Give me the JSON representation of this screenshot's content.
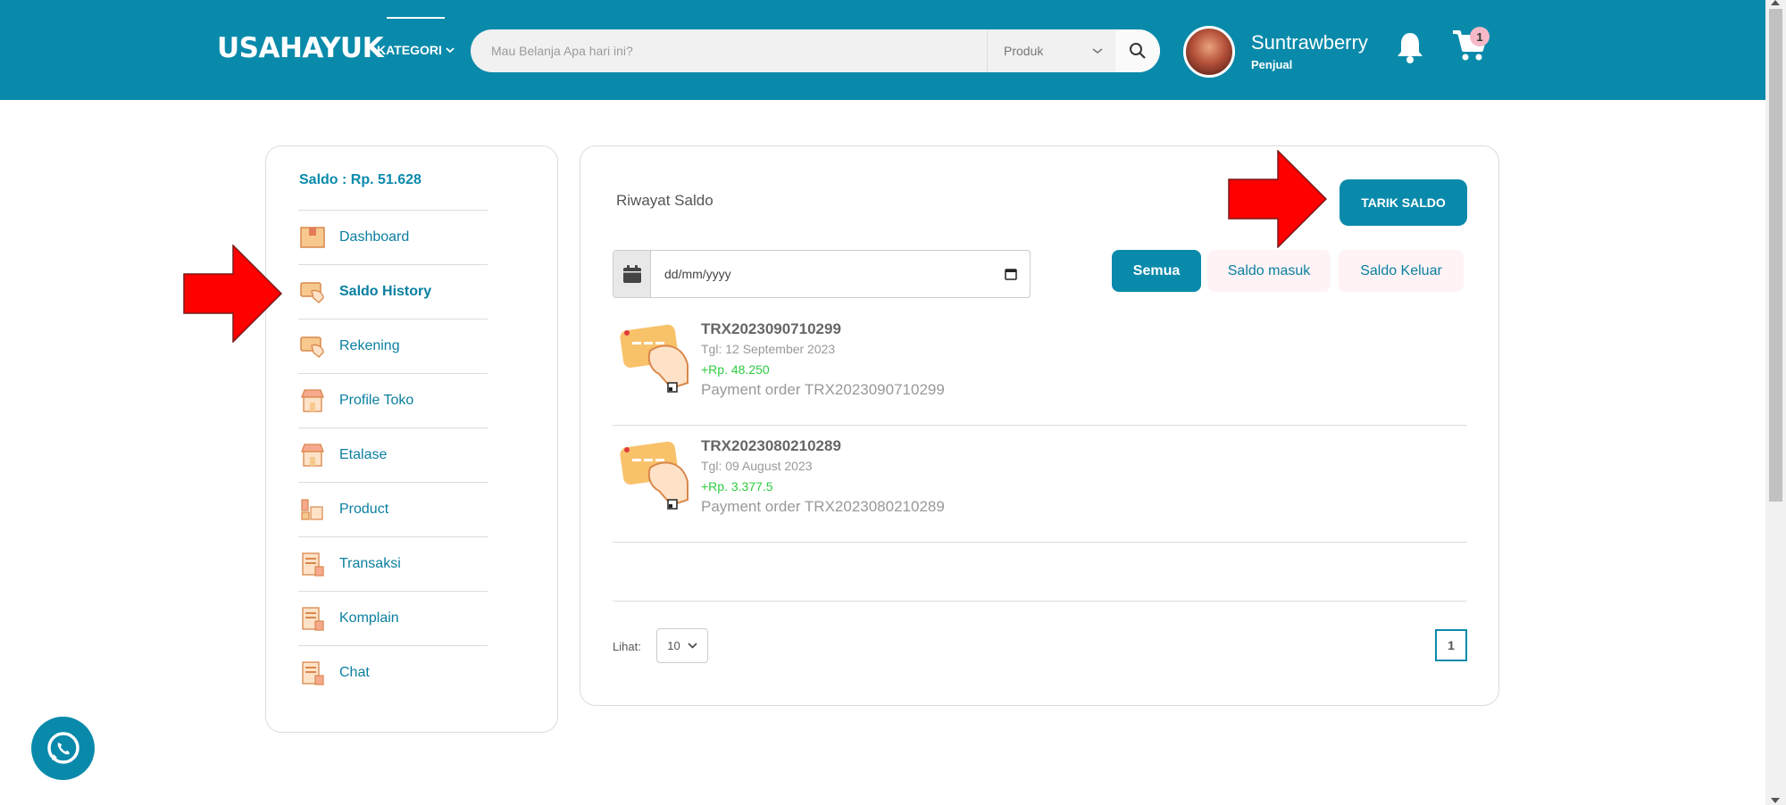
{
  "header": {
    "logo": "USAHAYUK",
    "kategori_label": "KATEGORI",
    "search_placeholder": "Mau Belanja Apa hari ini?",
    "search_category": "Produk",
    "user_name": "Suntrawberry",
    "user_role": "Penjual",
    "cart_count": "1"
  },
  "sidebar": {
    "saldo": "Saldo : Rp. 51.628",
    "items": [
      {
        "label": "Dashboard",
        "icon": "box-icon"
      },
      {
        "label": "Saldo History",
        "icon": "card-hand-icon"
      },
      {
        "label": "Rekening",
        "icon": "card-hand-icon"
      },
      {
        "label": "Profile Toko",
        "icon": "store-icon"
      },
      {
        "label": "Etalase",
        "icon": "store-icon"
      },
      {
        "label": "Product",
        "icon": "product-icon"
      },
      {
        "label": "Transaksi",
        "icon": "document-icon"
      },
      {
        "label": "Komplain",
        "icon": "document-icon"
      },
      {
        "label": "Chat",
        "icon": "document-icon"
      }
    ],
    "active_index": 1
  },
  "main": {
    "title": "Riwayat Saldo",
    "tarik_button": "TARIK SALDO",
    "date_placeholder": "dd/mm/yyyy",
    "filters": [
      "Semua",
      "Saldo masuk",
      "Saldo Keluar"
    ],
    "active_filter": "Semua",
    "transactions": [
      {
        "id": "TRX2023090710299",
        "date": "Tgl: 12 September 2023",
        "amount": "+Rp. 48.250",
        "description": "Payment order TRX2023090710299"
      },
      {
        "id": "TRX2023080210289",
        "date": "Tgl: 09 August 2023",
        "amount": "+Rp. 3.377.5",
        "description": "Payment order TRX2023080210289"
      }
    ],
    "lihat_label": "Lihat:",
    "lihat_value": "10",
    "current_page": "1"
  },
  "colors": {
    "primary": "#0a8aab",
    "annotation_arrow": "#ff0000",
    "positive_amount": "#2ecc40"
  }
}
